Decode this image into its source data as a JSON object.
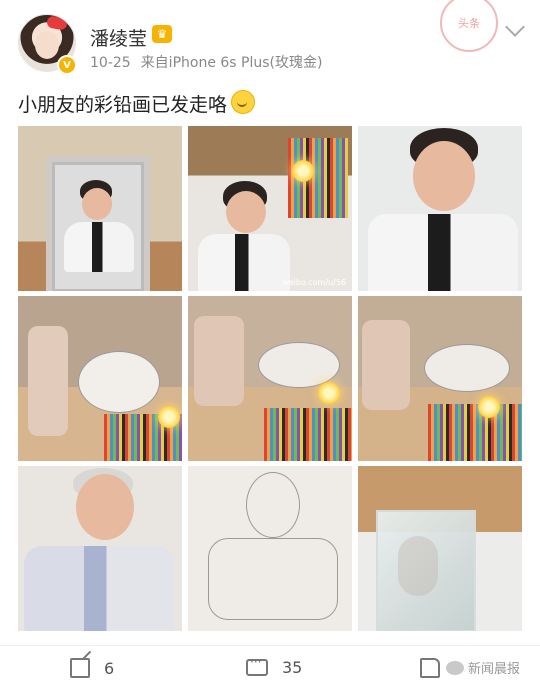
{
  "post": {
    "username": "潘绫莹",
    "date": "10-25",
    "source": "来自iPhone 6s Plus(玫瑰金)",
    "stamp_text": "头条",
    "text": "小朋友的彩铅画已发走咯",
    "image_watermark": "weibo.com/u/56"
  },
  "actions": {
    "repost_count": "6",
    "comment_count": "35",
    "brand": "新闻晨报"
  },
  "icons": {
    "repost": "share-icon",
    "comment": "comment-icon",
    "like": "like-icon",
    "verified": "verified-badge-icon",
    "more": "chevron-down-icon"
  },
  "colors": {
    "vip_badge": "#f6b400",
    "text_primary": "#333333",
    "text_meta": "#888888"
  }
}
